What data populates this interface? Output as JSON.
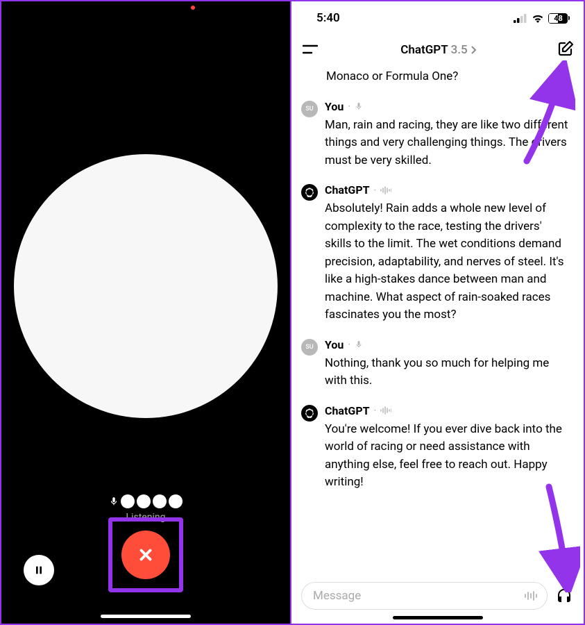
{
  "left": {
    "status": "Listening",
    "icons": {
      "pause": "pause-icon",
      "close": "close-icon",
      "mic": "microphone-icon"
    }
  },
  "right": {
    "status_bar": {
      "time": "5:40",
      "battery": "48",
      "battery_pct_width": "48%"
    },
    "header": {
      "title": "ChatGPT",
      "version": "3.5"
    },
    "messages": [
      {
        "author": "",
        "avatar": null,
        "indicator": null,
        "text": "Monaco or Formula One?"
      },
      {
        "author": "You",
        "avatar": "SU",
        "indicator": "mic",
        "text": "Man, rain and racing, they are like two different things and very challenging things. The drivers must be very skilled."
      },
      {
        "author": "ChatGPT",
        "avatar": "gpt",
        "indicator": "wave",
        "text": "Absolutely! Rain adds a whole new level of complexity to the race, testing the drivers' skills to the limit. The wet conditions demand precision, adaptability, and nerves of steel. It's like a high-stakes dance between man and machine. What aspect of rain-soaked races fascinates you the most?"
      },
      {
        "author": "You",
        "avatar": "SU",
        "indicator": "mic",
        "text": "Nothing, thank you so much for helping me with this."
      },
      {
        "author": "ChatGPT",
        "avatar": "gpt",
        "indicator": "wave",
        "text": "You're welcome! If you ever dive back into the world of racing or need assistance with anything else, feel free to reach out. Happy writing!"
      }
    ],
    "input": {
      "placeholder": "Message"
    }
  },
  "annotations": {
    "color": "#9333ea"
  }
}
